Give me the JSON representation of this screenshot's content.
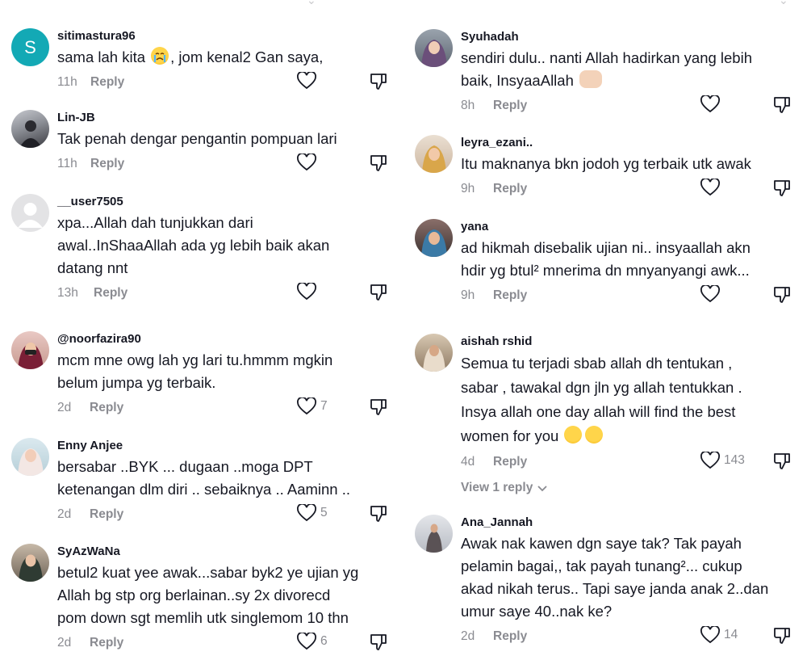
{
  "actions": {
    "reply_label": "Reply",
    "view_replies_label": "View 1 reply"
  },
  "left_comments": [
    {
      "username": "sitimastura96",
      "avatar": "letter-S",
      "avatar_letter": "S",
      "lines": [
        "sama lah kita",
        ", jom kenal2 Gan saya,"
      ],
      "emoji_inline": "crying-face",
      "time": "11h",
      "likes": ""
    },
    {
      "username": "Lin-JB",
      "avatar": "photo",
      "lines": [
        "Tak penah dengar pengantin pompuan lari"
      ],
      "time": "11h",
      "likes": ""
    },
    {
      "username": "__user7505",
      "avatar": "default-avatar",
      "lines": [
        "xpa...Allah dah tunjukkan dari",
        "awal..InShaaAllah ada yg lebih baik akan",
        "datang nnt"
      ],
      "time": "13h",
      "likes": ""
    },
    {
      "username": "@noorfazira90",
      "avatar": "photo",
      "lines": [
        "mcm mne owg lah yg lari tu.hmmm mgkin",
        "belum jumpa yg terbaik."
      ],
      "time": "2d",
      "likes": "7"
    },
    {
      "username": "Enny Anjee",
      "avatar": "photo",
      "lines": [
        "bersabar ..BYK ... dugaan ..moga DPT",
        "ketenangan dlm diri .. sebaiknya .. Aaminn .."
      ],
      "time": "2d",
      "likes": "5"
    },
    {
      "username": "SyAzWaNa",
      "avatar": "photo",
      "lines": [
        "betul2 kuat yee awak...sabar byk2 ye ujian yg",
        "Allah bg stp org berlainan..sy 2x divorecd",
        "pom down sgt memlih utk singlemom 10 thn"
      ],
      "time": "2d",
      "likes": "6"
    }
  ],
  "right_comments": [
    {
      "username": "Syuhadah",
      "avatar": "photo",
      "lines": [
        "sendiri dulu.. nanti Allah hadirkan yang lebih",
        "baik, InsyaaAllah"
      ],
      "emoji_end": "praying-hands",
      "time": "8h",
      "likes": ""
    },
    {
      "username": "leyra_ezani..",
      "avatar": "photo",
      "lines": [
        "Itu maknanya bkn jodoh yg terbaik utk awak"
      ],
      "time": "9h",
      "likes": ""
    },
    {
      "username": "yana",
      "avatar": "photo",
      "lines": [
        "ad hikmah disebalik ujian ni.. insyaallah akn",
        "hdir yg btul² mnerima dn mnyanyangi awk..."
      ],
      "time": "9h",
      "likes": ""
    },
    {
      "username": "aishah rshid",
      "avatar": "photo",
      "lines": [
        "Semua tu terjadi sbab allah dh tentukan ,",
        "sabar , tawakal dgn jln yg allah tentukkan .",
        "Insya allah one day allah will find the best",
        "women for you"
      ],
      "emoji_end": "smiling-faces",
      "time": "4d",
      "likes": "143"
    },
    {
      "username": "Ana_Jannah",
      "avatar": "photo",
      "lines": [
        "Awak nak kawen dgn saye tak? Tak payah",
        "pelamin bagai,, tak payah tunang²... cukup",
        "akad nikah terus.. Tapi saye janda anak 2..dan",
        "umur saye 40..nak ke?"
      ],
      "time": "2d",
      "likes": "14"
    }
  ],
  "colors": {
    "text": "#161823",
    "muted": "#8a8b91",
    "avatar_teal": "#13a9b5",
    "icon": "#161823"
  }
}
